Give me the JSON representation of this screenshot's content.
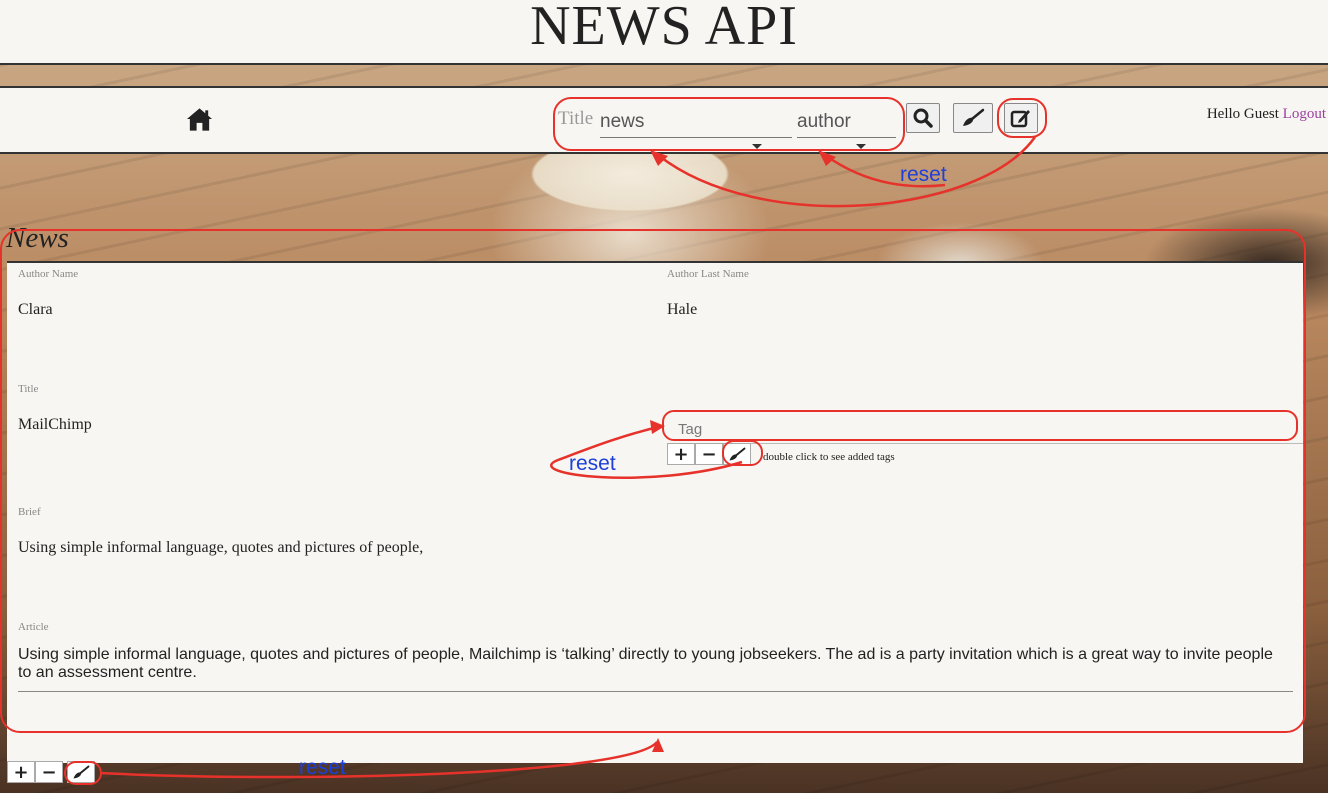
{
  "site": {
    "title": "NEWS API"
  },
  "nav": {
    "home_icon": "home-icon",
    "title_label": "Title",
    "news_value": "news",
    "author_value": "author",
    "search_icon": "search-icon",
    "clear_icon": "broom-icon",
    "edit_icon": "edit-icon",
    "greeting": "Hello Guest",
    "logout": "Logout"
  },
  "section": {
    "heading": "News",
    "fields": {
      "author_name_label": "Author Name",
      "author_name_value": "Clara",
      "author_last_label": "Author Last Name",
      "author_last_value": "Hale",
      "title_label": "Title",
      "title_value": "MailChimp",
      "tag_placeholder": "Tag",
      "tag_hint": "double click to see added tags",
      "brief_label": "Brief",
      "brief_value": "Using simple informal language, quotes and pictures of people,",
      "article_label": "Article",
      "article_value": "Using simple informal language, quotes and pictures of people, Mailchimp is ‘talking’ directly to young jobseekers. The ad is a party invitation which is a great way to invite people to an assessment centre."
    },
    "tag_buttons": {
      "add": "+",
      "remove": "−"
    },
    "bottom_buttons": {
      "add": "+",
      "remove": "−"
    }
  },
  "annotations": {
    "reset_top": "reset",
    "reset_tag": "reset",
    "reset_bottom": "reset",
    "color": "#e6322a",
    "label_color": "#1e3fd8"
  }
}
